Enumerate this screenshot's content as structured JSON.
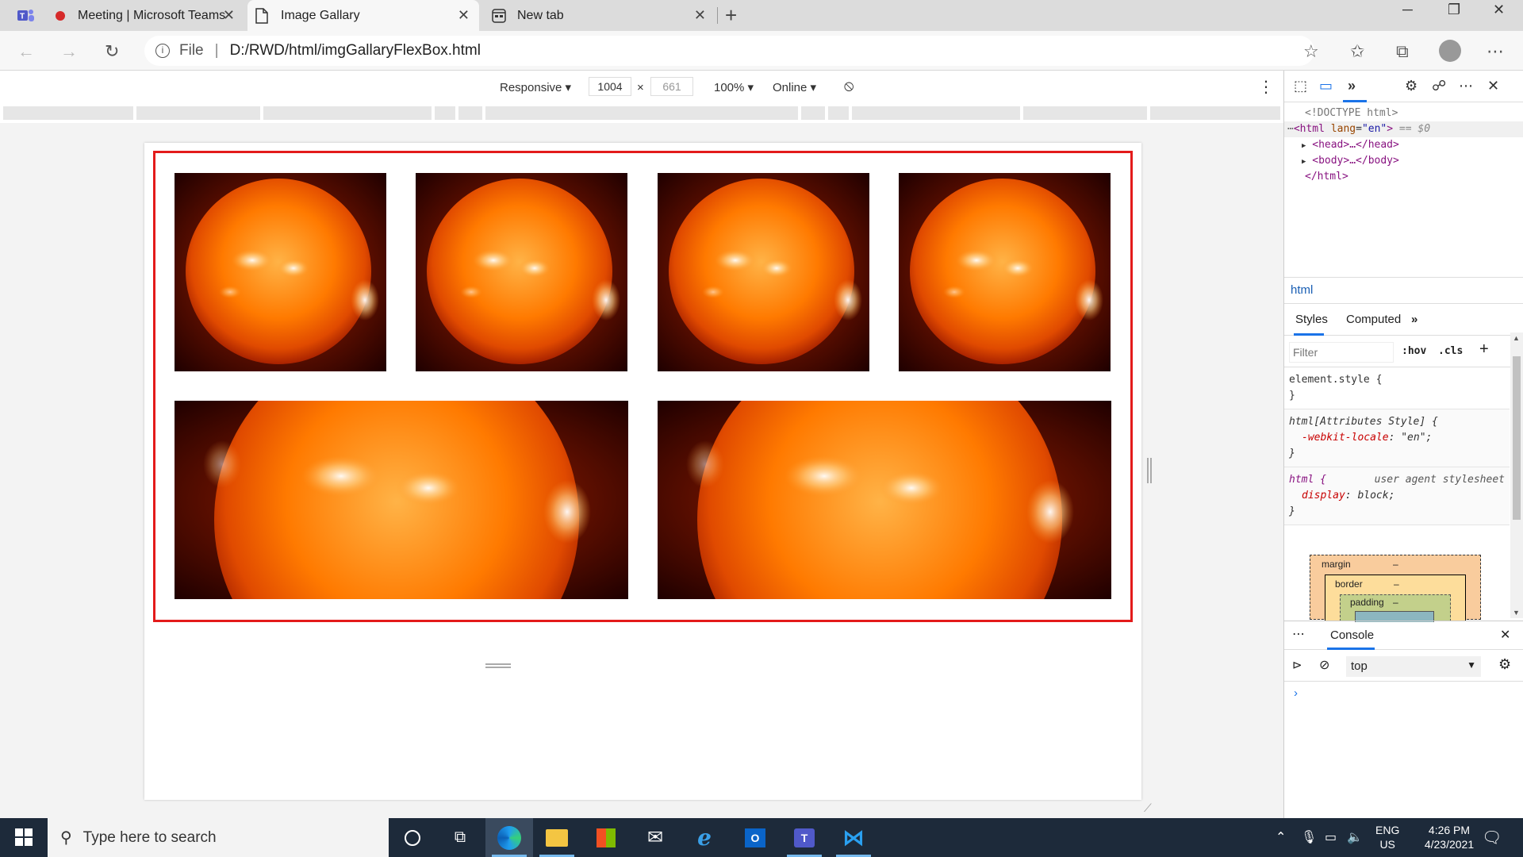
{
  "browser": {
    "tabs": [
      {
        "title": "Meeting | Microsoft Teams",
        "active": false
      },
      {
        "title": "Image Gallary",
        "active": true
      },
      {
        "title": "New tab",
        "active": false
      }
    ],
    "address": {
      "scheme_label": "File",
      "url": "D:/RWD/html/imgGallaryFlexBox.html"
    }
  },
  "device_toolbar": {
    "mode": "Responsive",
    "width": "1004",
    "height": "661",
    "zoom": "100%",
    "throttle": "Online"
  },
  "gallery": {
    "border_color": "#e31b1b",
    "row1_count": 4,
    "row2_count": 2
  },
  "devtools": {
    "dom": {
      "doctype": "<!DOCTYPE html>",
      "html_open": "<html",
      "lang_attr": "lang",
      "lang_value": "\"en\"",
      "eq0": "== $0",
      "head": "<head>…</head>",
      "body": "<body>…</body>",
      "html_close": "</html>"
    },
    "breadcrumb": "html",
    "subtabs": {
      "styles": "Styles",
      "computed": "Computed"
    },
    "filter_placeholder": "Filter",
    "hov": ":hov",
    "cls": ".cls",
    "rules": {
      "element_style": "element.style {",
      "close": "}",
      "attr_selector": "html[Attributes Style] {",
      "webkit_locale_name": "-webkit-locale",
      "webkit_locale_value": "\"en\";",
      "html_selector": "html {",
      "ua_label": "user agent stylesheet",
      "display_name": "display",
      "display_value": "block;"
    },
    "boxmodel": {
      "margin": "margin",
      "border": "border",
      "padding": "padding",
      "dash": "–"
    },
    "console_tab": "Console",
    "context": "top",
    "prompt": "›"
  },
  "taskbar": {
    "search_placeholder": "Type here to search",
    "lang": "ENG",
    "region": "US",
    "time": "4:26 PM",
    "date": "4/23/2021"
  }
}
